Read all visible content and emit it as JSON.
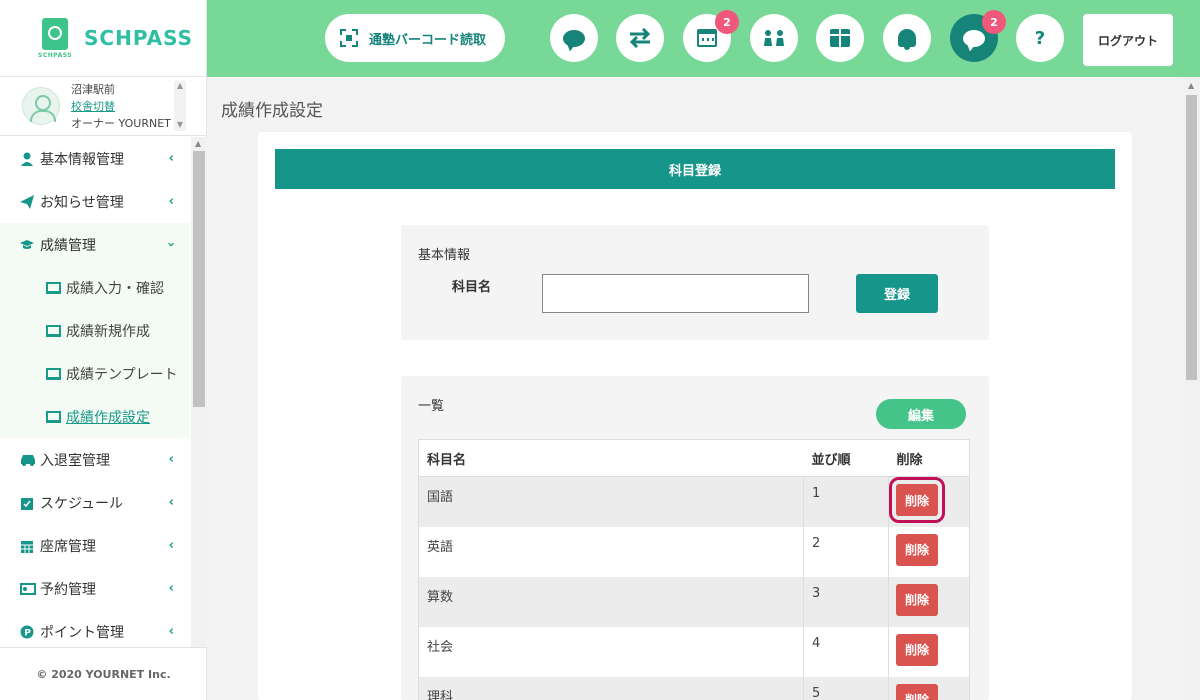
{
  "brand": {
    "name": "SCHPASS",
    "sub": "SCHPASS"
  },
  "user": {
    "school": "沼津駅前",
    "switch_link": "校舎切替",
    "role": "オーナー YOURNET"
  },
  "sidebar": {
    "items": [
      {
        "label": "基本情報管理",
        "icon": "user-icon"
      },
      {
        "label": "お知らせ管理",
        "icon": "paper-plane-icon"
      },
      {
        "label": "成績管理",
        "icon": "graduation-cap-icon"
      },
      {
        "label": "入退室管理",
        "icon": "car-icon"
      },
      {
        "label": "スケジュール",
        "icon": "calendar-check-icon"
      },
      {
        "label": "座席管理",
        "icon": "calendar-grid-icon"
      },
      {
        "label": "予約管理",
        "icon": "reservation-icon"
      },
      {
        "label": "ポイント管理",
        "icon": "point-icon"
      }
    ],
    "subitems": [
      {
        "label": "成績入力・確認"
      },
      {
        "label": "成績新規作成"
      },
      {
        "label": "成績テンプレート"
      },
      {
        "label": "成績作成設定"
      }
    ]
  },
  "footer": {
    "copyright": "© 2020 YOURNET Inc."
  },
  "topbar": {
    "barcode_label": "通塾バーコード読取",
    "calendar_badge": "2",
    "message_badge": "2",
    "help_label": "?",
    "logout_label": "ログアウト"
  },
  "main": {
    "page_title": "成績作成設定",
    "card_title": "科目登録",
    "basic_title": "基本情報",
    "subject_label": "科目名",
    "subject_value": "",
    "register_label": "登録",
    "list_title": "一覧",
    "edit_label": "編集",
    "table": {
      "headers": [
        "科目名",
        "並び順",
        "削除"
      ],
      "delete_label": "削除",
      "rows": [
        {
          "name": "国語",
          "order": "1"
        },
        {
          "name": "英語",
          "order": "2"
        },
        {
          "name": "算数",
          "order": "3"
        },
        {
          "name": "社会",
          "order": "4"
        },
        {
          "name": "理科",
          "order": "5"
        }
      ]
    }
  },
  "colors": {
    "accent": "#16958a",
    "topbar": "#78d898",
    "badge": "#f0587b",
    "delete": "#d9534f",
    "highlight": "#c0105a"
  }
}
